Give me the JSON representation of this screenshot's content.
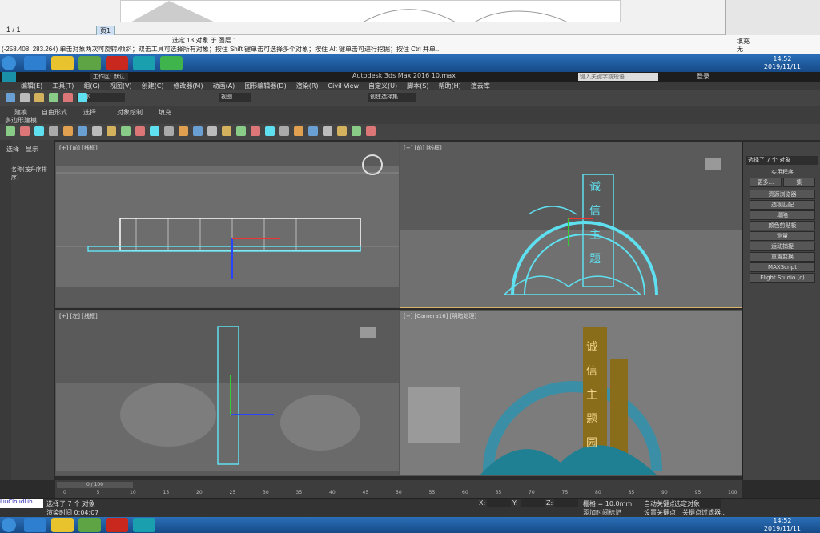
{
  "doc": {
    "page": "1 / 1",
    "tab": "页1",
    "status_selected": "选定 13 对象 于 图层 1",
    "status_hint": "(-258.408, 283.264)  单击对象两次可旋转/倾斜；双击工具可选择所有对象；按住 Shift 键单击可选择多个对象；按住 Alt 键单击可进行挖掘；按住 Ctrl 并单...",
    "fill_label": "填充",
    "none_label": "无"
  },
  "taskbar_top": {
    "time": "14:52",
    "date": "2019/11/11"
  },
  "max": {
    "workspace": "工作区: 默认",
    "title": "Autodesk 3ds Max 2016     10.max",
    "search_placeholder": "键入关键字或短语",
    "login": "登录",
    "menus": [
      "编辑(E)",
      "工具(T)",
      "组(G)",
      "视图(V)",
      "创建(C)",
      "修改器(M)",
      "动画(A)",
      "图形编辑器(D)",
      "渲染(R)",
      "Civil View",
      "自定义(U)",
      "脚本(S)",
      "帮助(H)",
      "渲云库"
    ],
    "select_filter": "全部",
    "view_dropdown": "视图",
    "selection_set": "创建选择集",
    "ribbon_tabs": [
      "建模",
      "自由形式",
      "选择",
      "对象绘制",
      "填充"
    ],
    "ribbon_sub": "多边形建模",
    "scene_tabs": [
      "选择",
      "显示"
    ],
    "scene_sort": "名称(按升序排序)"
  },
  "viewports": {
    "top_left": "[+] [前] [线框]",
    "top_right": "[+] [前] [线框]",
    "bottom_left": "[+] [左] [线框]",
    "bottom_right": "[+] [Camera16] [明暗处理]"
  },
  "command_panel": {
    "selection": "选择了 7 个 对象",
    "group_title": "实用程序",
    "more": "更多...",
    "sets": "集",
    "buttons": [
      "资源浏览器",
      "透视匹配",
      "塌陷",
      "颜色剪贴板",
      "测量",
      "运动捕捉",
      "重置变换",
      "MAXScript",
      "Flight Studio (c)"
    ]
  },
  "timeline": {
    "frame": "0 / 100",
    "ticks": [
      "0",
      "5",
      "10",
      "15",
      "20",
      "25",
      "30",
      "35",
      "40",
      "45",
      "50",
      "55",
      "60",
      "65",
      "70",
      "75",
      "80",
      "85",
      "90",
      "95",
      "100"
    ]
  },
  "status": {
    "selected": "选择了 7 个 对象",
    "render_time": "渲染时间 0:04:07",
    "grid": "栅格 = 10.0mm",
    "auto_key": "自动关键点",
    "set_key": "设置关键点",
    "selected_obj": "选定对象",
    "key_filter": "关键点过滤器...",
    "add_time_tag": "添加时间标记",
    "x_label": "X:",
    "y_label": "Y:",
    "z_label": "Z:",
    "script_box": "LiuCloudLib"
  },
  "taskbar_bottom": {
    "time": "14:52",
    "date": "2019/11/11"
  },
  "colors": {
    "accent_blue": "#1d6bb8",
    "viewport_bg": "#5a5a5a",
    "cyan_wire": "#5fe0f0"
  }
}
